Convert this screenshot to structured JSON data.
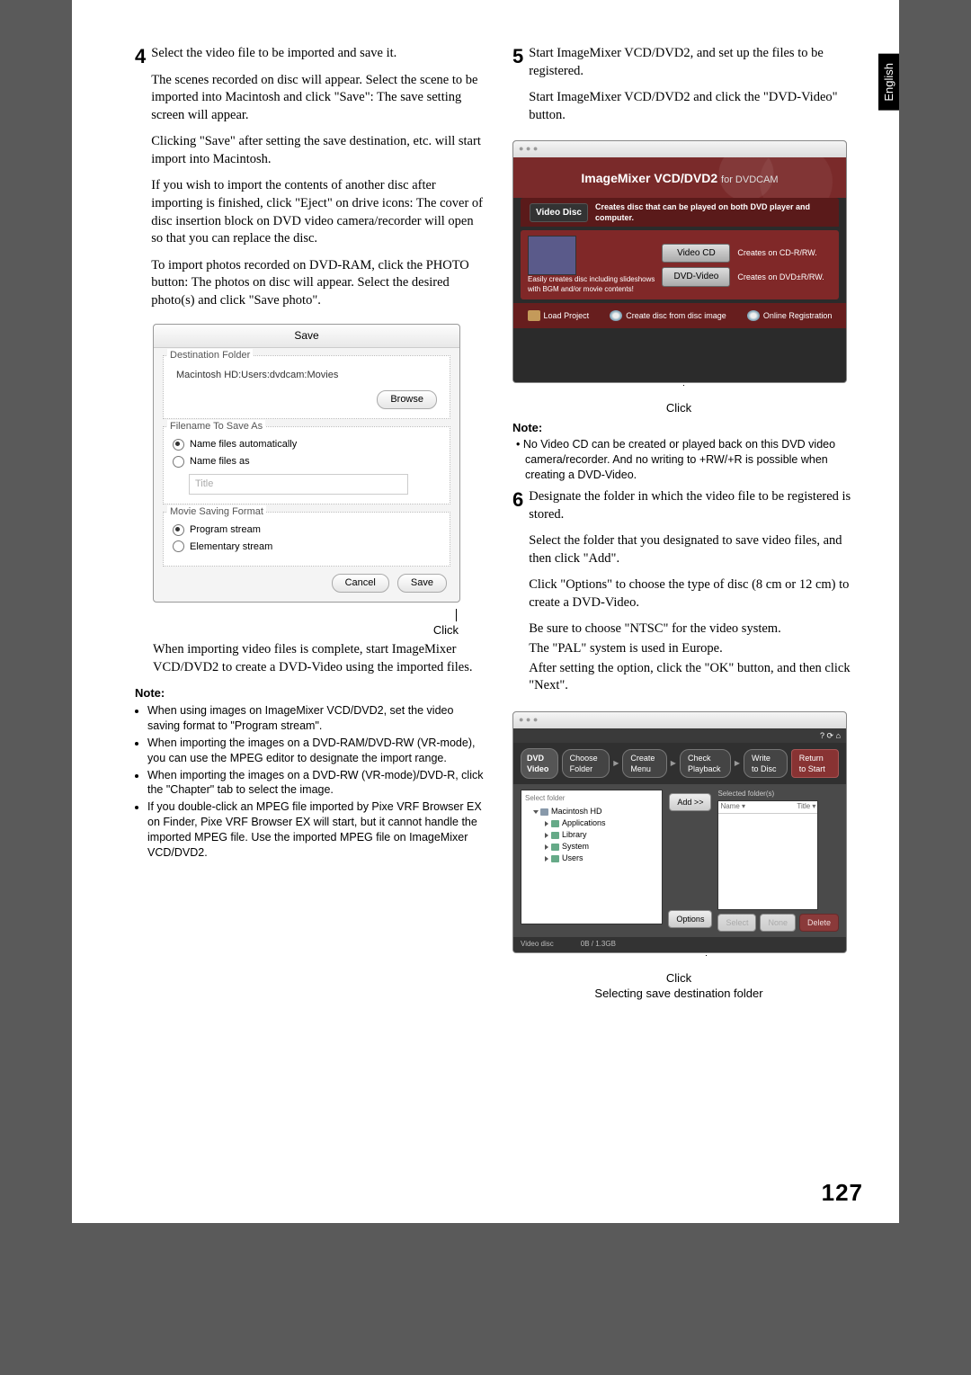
{
  "lang_tab": "English",
  "page_number": "127",
  "left": {
    "step4_num": "4",
    "step4_lead": "Select the video file to be imported and save it.",
    "step4_p1": "The scenes recorded on disc will appear. Select the scene to be imported into Macintosh and click \"Save\": The save setting screen will appear.",
    "step4_p2": "Clicking \"Save\" after setting the save destination, etc. will start import into Macintosh.",
    "step4_p3": "If you wish to import the contents of another disc after importing is finished, click \"Eject\" on drive icons: The cover of disc insertion block on DVD video camera/recorder will open so that you can replace the disc.",
    "step4_p4": "To import photos recorded on DVD-RAM, click the PHOTO button: The photos on disc will appear. Select the desired photo(s) and click \"Save photo\".",
    "dialog": {
      "title": "Save",
      "dest_legend": "Destination Folder",
      "dest_path": "Macintosh HD:Users:dvdcam:Movies",
      "browse": "Browse",
      "name_legend": "Filename To Save As",
      "radio_auto": "Name files automatically",
      "radio_as": "Name files as",
      "title_placeholder": "Title",
      "format_legend": "Movie Saving Format",
      "radio_prog": "Program stream",
      "radio_elem": "Elementary stream",
      "cancel": "Cancel",
      "save": "Save"
    },
    "click_label": "Click",
    "after_dialog": "When importing video files is complete, start ImageMixer VCD/DVD2 to create a DVD-Video using the imported files.",
    "note_label": "Note:",
    "notes": [
      "When using images on ImageMixer VCD/DVD2, set the video saving format to \"Program stream\".",
      "When importing the images on a DVD-RAM/DVD-RW (VR-mode), you can use the MPEG editor to designate the import range.",
      "When importing the images on a DVD-RW (VR-mode)/DVD-R, click the \"Chapter\" tab to select the image.",
      "If you double-click an MPEG file imported by Pixe VRF Browser EX on Finder, Pixe VRF Browser EX will start, but it cannot handle the imported MPEG file. Use the imported MPEG file on ImageMixer VCD/DVD2."
    ]
  },
  "right": {
    "step5_num": "5",
    "step5_lead": "Start ImageMixer VCD/DVD2, and set up the files to be registered.",
    "step5_p1": "Start ImageMixer VCD/DVD2 and click the \"DVD-Video\" button.",
    "imx": {
      "logo_main": "ImageMixer VCD/DVD2",
      "logo_small": "for DVDCAM",
      "video_disc": "Video Disc",
      "video_disc_desc": "Creates disc that can be played on both DVD player and computer.",
      "btn_vcd": "Video CD",
      "btn_vcd_desc": "Creates on CD-R/RW.",
      "btn_dvd": "DVD-Video",
      "btn_dvd_desc": "Creates on DVD±R/RW.",
      "side_l1": "Easily creates disc including slideshows",
      "side_l2": "with BGM and/or movie contents!",
      "foot_load": "Load Project",
      "foot_create": "Create disc from disc image",
      "foot_reg": "Online Registration"
    },
    "click_label": "Click",
    "note_label": "Note:",
    "note5": "No Video CD can be created or played back on this DVD video camera/recorder. And no writing to +RW/+R is possible when creating a DVD-Video.",
    "step6_num": "6",
    "step6_lead": "Designate the folder in which the video file to be registered is stored.",
    "step6_p1": "Select the folder that you designated to save video files, and then click \"Add\".",
    "step6_p2": "Click \"Options\" to choose the type of disc (8 cm or 12 cm) to create a DVD-Video.",
    "step6_p3": "Be sure to choose \"NTSC\" for the video system.",
    "step6_p4": "The \"PAL\" system is used in Europe.",
    "step6_p5": "After setting the option, click the \"OK\" button, and then click \"Next\".",
    "chooser": {
      "logo": "DVD Video",
      "tab1": "Choose Folder",
      "tab2": "Create Menu",
      "tab3": "Check Playback",
      "tab4": "Write to Disc",
      "return": "Return to Start",
      "tree_hdr": "Select folder",
      "tree_root": "Macintosh HD",
      "tree_items": [
        "Applications",
        "Library",
        "System",
        "Users"
      ],
      "sel_hdr": "Selected folder(s)",
      "sel_col1": "Name ▾",
      "sel_col2": "Title ▾",
      "add": "Add >>",
      "options": "Options",
      "btn_sel": "Select",
      "btn_none": "None",
      "btn_del": "Delete",
      "status_l": "Video disc",
      "status_r": "0B / 1.3GB"
    },
    "caption_click": "Click",
    "caption_sub": "Selecting save destination folder"
  }
}
